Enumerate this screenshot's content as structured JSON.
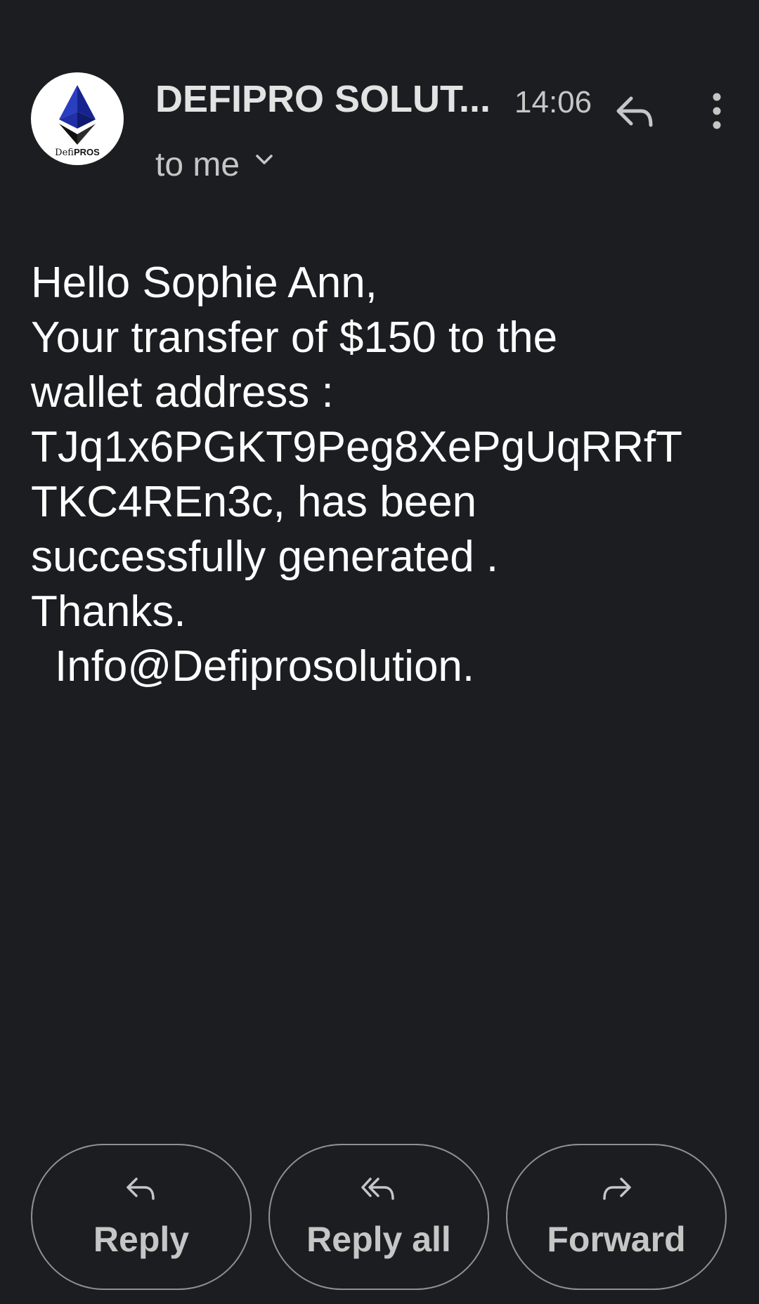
{
  "email": {
    "sender": "DEFIPRO SOLUT...",
    "avatar_text": {
      "prefix": "Defi",
      "suffix": "PROS"
    },
    "time": "14:06",
    "recipient": "to me",
    "body_lines": [
      "Hello Sophie Ann,",
      "Your transfer of $150 to the",
      "wallet address :",
      "TJq1x6PGKT9Peg8XePgUqRRfT",
      "TKC4REn3c, has been",
      "successfully generated .",
      "Thanks.",
      "Info@Defiprosolution."
    ]
  },
  "actions": {
    "reply": "Reply",
    "reply_all": "Reply all",
    "forward": "Forward"
  },
  "icons": {
    "avatar": "defipros-logo-icon",
    "reply_top": "reply-icon",
    "more": "more-vert-icon",
    "recipient_expand": "chevron-down-icon",
    "reply": "reply-icon",
    "reply_all": "reply-all-icon",
    "forward": "forward-icon"
  },
  "colors": {
    "background": "#1b1d20",
    "primary_text": "#e3e3e3",
    "secondary_text": "#c4c7c5",
    "body_text": "#ffffff",
    "button_border": "#8e918f",
    "logo_blue": "#1e2fa8"
  }
}
